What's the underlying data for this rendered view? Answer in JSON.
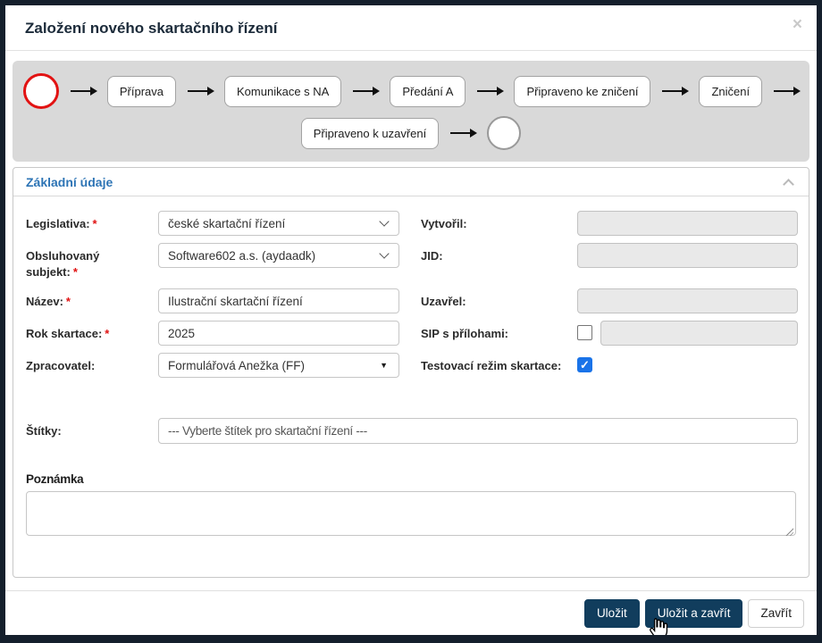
{
  "modal": {
    "title": "Založení nového skartačního řízení",
    "close_icon": "×"
  },
  "colors": {
    "navy_button": "#113d5d",
    "section_header_blue": "#2d74b5",
    "start_circle_red": "#e21212",
    "checkbox_checked_blue": "#1a73e8",
    "workflow_background": "#d9d9d9"
  },
  "workflow": {
    "row1_steps": [
      "Příprava",
      "Komunikace s NA",
      "Předání A",
      "Připraveno ke zničení",
      "Zničení"
    ],
    "row2_steps": [
      "Připraveno k uzavření"
    ]
  },
  "section_title": "Základní údaje",
  "required_marker": "*",
  "fields": {
    "legislativa": {
      "label": "Legislativa:",
      "value": "české skartační řízení",
      "required": true
    },
    "obsluhovany_subjekt": {
      "label": "Obsluhovaný subjekt:",
      "value": "Software602 a.s. (aydaadk)",
      "required": true
    },
    "nazev": {
      "label": "Název:",
      "value": "Ilustrační skartační řízení",
      "required": true
    },
    "rok_skartace": {
      "label": "Rok skartace:",
      "value": "2025",
      "required": true
    },
    "zpracovatel": {
      "label": "Zpracovatel:",
      "value": "Formulářová Anežka (FF)",
      "required": false
    },
    "vytvoril": {
      "label": "Vytvořil:",
      "value": "",
      "disabled": true
    },
    "jid": {
      "label": "JID:",
      "value": "",
      "disabled": true
    },
    "uzavrel": {
      "label": "Uzavřel:",
      "value": "",
      "disabled": true
    },
    "sip_s_prilohami": {
      "label": "SIP s přílohami:",
      "checked": false,
      "value": "",
      "disabled": true
    },
    "testovaci_rezim": {
      "label": "Testovací režim skartace:",
      "checked": true,
      "checkmark": "✓"
    },
    "stitky": {
      "label": "Štítky:",
      "placeholder": "--- Vyberte štítek pro skartační řízení ---"
    },
    "poznamka": {
      "label": "Poznámka",
      "value": ""
    }
  },
  "footer": {
    "save_label": "Uložit",
    "save_close_label": "Uložit a zavřít",
    "close_label": "Zavřít"
  }
}
